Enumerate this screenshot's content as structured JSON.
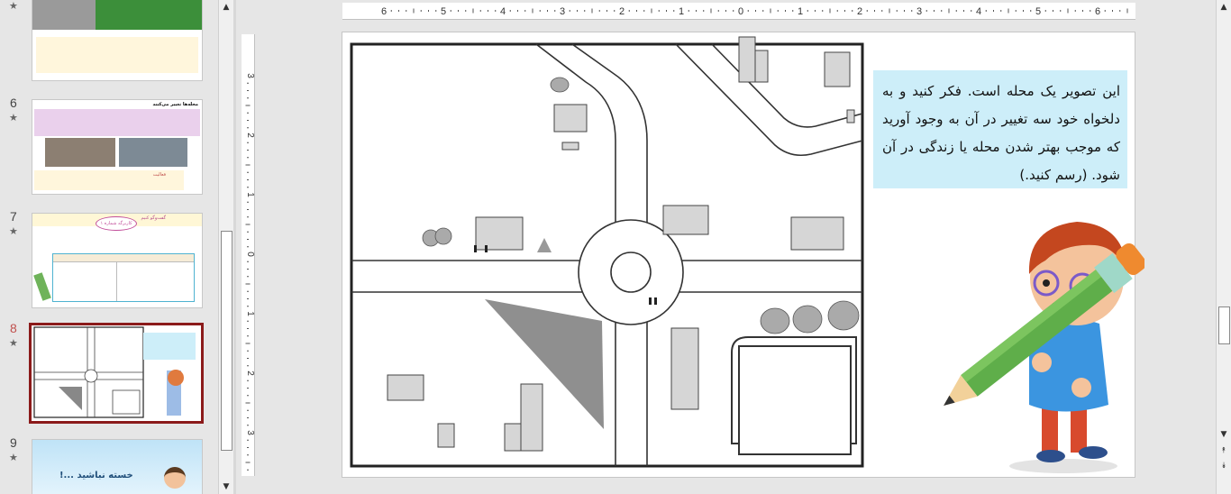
{
  "thumbnails": {
    "items": [
      {
        "number": "",
        "selected": false
      },
      {
        "number": "6",
        "selected": false,
        "title": "محله‌ها تغییر می‌کنند",
        "activity_label": "فعالیت"
      },
      {
        "number": "7",
        "selected": false,
        "header": "گفت‌وگو کنیم",
        "badge": "کاربرگه شماره ۱"
      },
      {
        "number": "8",
        "selected": true
      },
      {
        "number": "9",
        "selected": false,
        "text": "خسته نباشید ...!"
      }
    ],
    "star": "★"
  },
  "ruler": {
    "h_ticks": [
      "6",
      "5",
      "4",
      "3",
      "2",
      "1",
      "0",
      "1",
      "2",
      "3",
      "4",
      "5",
      "6"
    ],
    "v_ticks": [
      "3",
      "2",
      "1",
      "0",
      "1",
      "2",
      "3"
    ]
  },
  "scrollbars": {
    "up": "▲",
    "down": "▼",
    "prev_slide": "⯭",
    "next_slide": "⯯"
  },
  "slide": {
    "text": "این تصویر یک محله است. فکر کنید و به دلخواه خود سه تغییر در آن به وجود آورید که موجب بهتر شدن محله یا زندگی در آن شود. (رسم کنید.)",
    "colors": {
      "textbox_bg": "#cdeef9",
      "selection_border": "#8b1a1a"
    },
    "illustration": "neighborhood-map-drawing",
    "character": "boy-with-pencil"
  }
}
